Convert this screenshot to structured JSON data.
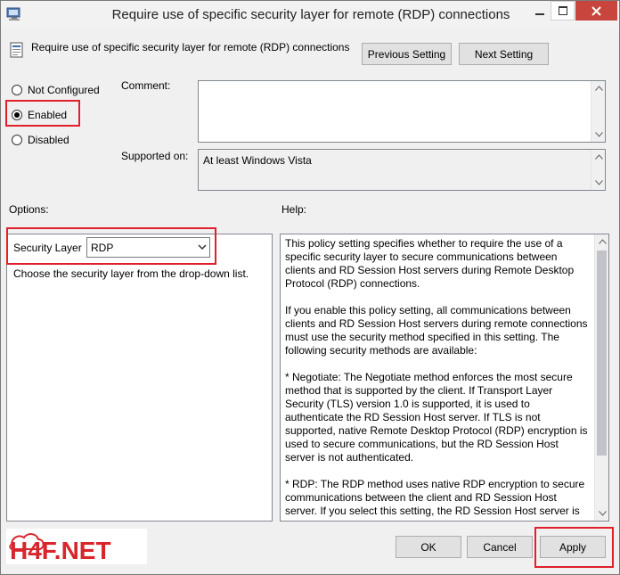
{
  "window": {
    "title": "Require use of specific security layer for remote (RDP) connections"
  },
  "header": {
    "policy_name": "Require use of specific security layer for remote (RDP) connections",
    "previous_label": "Previous Setting",
    "next_label": "Next Setting"
  },
  "state": {
    "options": [
      {
        "label": "Not Configured",
        "selected": false
      },
      {
        "label": "Enabled",
        "selected": true
      },
      {
        "label": "Disabled",
        "selected": false
      }
    ]
  },
  "comment": {
    "label": "Comment:",
    "value": ""
  },
  "supported": {
    "label": "Supported on:",
    "value": "At least Windows Vista"
  },
  "options_panel": {
    "heading": "Options:",
    "security_layer_label": "Security Layer",
    "security_layer_value": "RDP",
    "description": "Choose the security layer from the drop-down list."
  },
  "help_panel": {
    "heading": "Help:",
    "paragraphs": [
      "This policy setting specifies whether to require the use of a specific security layer to secure communications between clients and RD Session Host servers during Remote Desktop Protocol (RDP) connections.",
      "If you enable this policy setting, all communications between clients and RD Session Host servers during remote connections must use the security method specified in this setting. The following security methods are available:",
      "* Negotiate: The Negotiate method enforces the most secure method that is supported by the client. If Transport Layer Security (TLS) version 1.0 is supported, it is used to authenticate the RD Session Host server. If TLS is not supported, native Remote Desktop Protocol (RDP) encryption is used to secure communications, but the RD Session Host server is not authenticated.",
      "* RDP: The RDP method uses native RDP encryption to secure communications between the client and RD Session Host server. If you select this setting, the RD Session Host server is not"
    ]
  },
  "footer": {
    "logo_text": "H4F.NET",
    "ok_label": "OK",
    "cancel_label": "Cancel",
    "apply_label": "Apply"
  },
  "colors": {
    "highlight": "#e0202a",
    "close_button": "#c7453c",
    "logo_red": "#d8262d"
  },
  "icons": [
    "app-icon",
    "minimize-icon",
    "maximize-icon",
    "close-icon",
    "policy-icon",
    "chevron-down-icon",
    "scroll-up-icon",
    "scroll-down-icon"
  ]
}
